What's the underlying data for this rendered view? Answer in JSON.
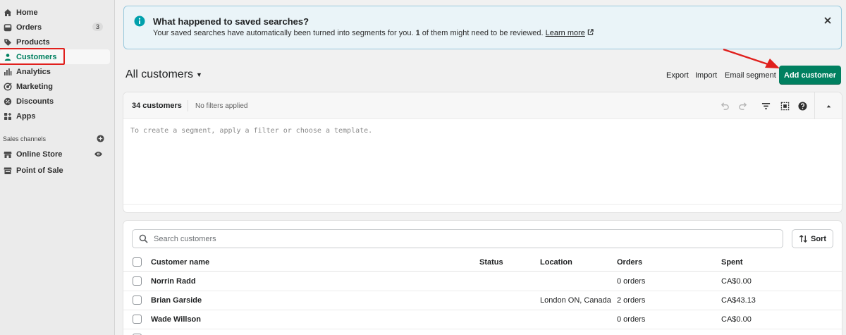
{
  "sidebar": {
    "items": [
      {
        "label": "Home",
        "icon": "home-icon"
      },
      {
        "label": "Orders",
        "icon": "orders-icon",
        "badge": "3"
      },
      {
        "label": "Products",
        "icon": "tag-icon"
      },
      {
        "label": "Customers",
        "icon": "person-icon",
        "active": true
      },
      {
        "label": "Analytics",
        "icon": "bar-chart-icon"
      },
      {
        "label": "Marketing",
        "icon": "target-icon"
      },
      {
        "label": "Discounts",
        "icon": "discount-icon"
      },
      {
        "label": "Apps",
        "icon": "apps-grid-icon"
      }
    ],
    "sales_channels_label": "Sales channels",
    "channels": [
      {
        "label": "Online Store",
        "icon": "store-icon",
        "trailing_icon": "eye-icon"
      },
      {
        "label": "Point of Sale",
        "icon": "pos-icon"
      }
    ]
  },
  "banner": {
    "title": "What happened to saved searches?",
    "body_prefix": "Your saved searches have automatically been turned into segments for you. ",
    "body_count": "1",
    "body_suffix": " of them might need to be reviewed. ",
    "link": "Learn more"
  },
  "header": {
    "title": "All customers",
    "actions": [
      "Export",
      "Import",
      "Email segment"
    ],
    "primary_button": "Add customer"
  },
  "segment": {
    "count": "34 customers",
    "filter_status": "No filters applied",
    "placeholder": "To create a segment, apply a filter or choose a template."
  },
  "list": {
    "search_placeholder": "Search customers",
    "sort_label": "Sort",
    "columns": [
      "Customer name",
      "Status",
      "Location",
      "Orders",
      "Spent"
    ],
    "rows": [
      {
        "name": "Norrin Radd",
        "status": "",
        "location": "",
        "orders": "0 orders",
        "spent": "CA$0.00"
      },
      {
        "name": "Brian Garside",
        "status": "",
        "location": "London ON, Canada",
        "orders": "2 orders",
        "spent": "CA$43.13"
      },
      {
        "name": "Wade Willson",
        "status": "",
        "location": "",
        "orders": "0 orders",
        "spent": "CA$0.00"
      }
    ]
  },
  "colors": {
    "accent": "#008060",
    "annotation_red": "#e0201d",
    "banner_bg": "#eaf4f8",
    "info_teal": "#00a0ac"
  }
}
